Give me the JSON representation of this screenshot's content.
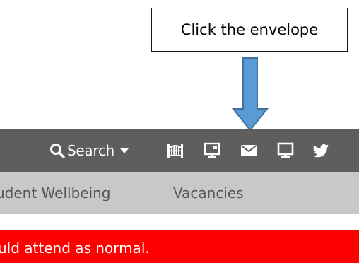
{
  "callout": {
    "text": "Click the envelope",
    "arrow_color": "#5b9bd5"
  },
  "toolbar": {
    "background": "#5e5e5e",
    "search_label": "Search",
    "icons": [
      "search-icon",
      "chevron-down-icon",
      "gate-icon",
      "monitor-icon",
      "envelope-icon",
      "desktop-icon",
      "twitter-icon"
    ]
  },
  "nav": {
    "background": "#c8c8c8",
    "items": [
      {
        "label": "udent Wellbeing"
      },
      {
        "label": "Vacancies"
      }
    ]
  },
  "alert": {
    "background": "#ff0000",
    "text": "uld attend as normal."
  }
}
